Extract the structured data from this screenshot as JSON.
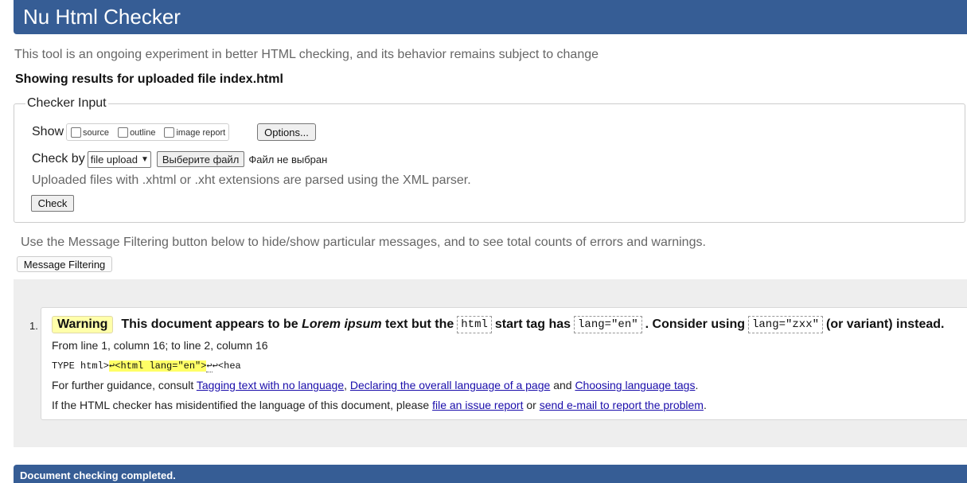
{
  "header": {
    "title": "Nu Html Checker"
  },
  "intro": "This tool is an ongoing experiment in better HTML checking, and its behavior remains subject to change",
  "results_for": "Showing results for uploaded file index.html",
  "checker_input": {
    "legend": "Checker Input",
    "show_label": "Show",
    "show_options": [
      "source",
      "outline",
      "image report"
    ],
    "options_button": "Options...",
    "check_by_label": "Check by",
    "check_by_value": "file upload",
    "file_button": "Выберите файл",
    "file_status": "Файл не выбран",
    "uploaded_note": "Uploaded files with .xhtml or .xht extensions are parsed using the XML parser.",
    "check_button": "Check"
  },
  "filter": {
    "note": "Use the Message Filtering button below to hide/show particular messages, and to see total counts of errors and warnings.",
    "button": "Message Filtering"
  },
  "message": {
    "number": "1.",
    "type": "Warning",
    "text_1": "This document appears to be",
    "em": "Lorem ipsum",
    "text_2": "text but the",
    "code_1": "html",
    "text_3": "start tag has",
    "code_2": "lang=\"en\"",
    "text_4": ". Consider using",
    "code_3": "lang=\"zxx\"",
    "text_5": "(or variant) instead.",
    "location": "From line 1, column 16; to line 2, column 16",
    "extract_before": "TYPE html>",
    "extract_highlight": "↩<html lang=\"en\">",
    "extract_after_lf": "↩",
    "extract_after": "↩<hea",
    "guidance_prefix": "For further guidance, consult",
    "link_1": "Tagging text with no language",
    "sep_1": ",",
    "link_2": "Declaring the overall language of a page",
    "and": "and",
    "link_3": "Choosing language tags",
    "period": ".",
    "misid_prefix": "If the HTML checker has misidentified the language of this document, please",
    "link_4": "file an issue report",
    "or": "or",
    "link_5": "send e-mail to report the problem",
    "period_2": "."
  },
  "footer": {
    "status": "Document checking completed."
  }
}
